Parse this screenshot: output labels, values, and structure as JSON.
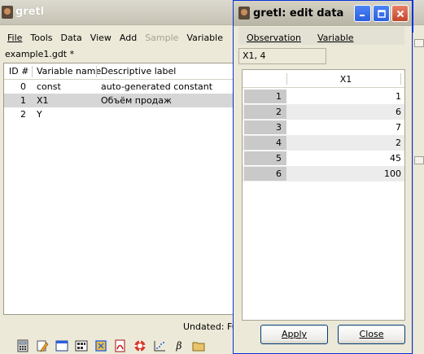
{
  "main_window": {
    "title": "gretl",
    "menus": [
      {
        "label": "File",
        "disabled": false
      },
      {
        "label": "Tools",
        "disabled": false
      },
      {
        "label": "Data",
        "disabled": false
      },
      {
        "label": "View",
        "disabled": false
      },
      {
        "label": "Add",
        "disabled": false
      },
      {
        "label": "Sample",
        "disabled": true
      },
      {
        "label": "Variable",
        "disabled": false
      }
    ],
    "file_label": "example1.gdt *",
    "columns": [
      "ID #",
      "Variable name",
      "Descriptive label"
    ],
    "variables": [
      {
        "id": "0",
        "name": "const",
        "label": "auto-generated constant",
        "selected": false
      },
      {
        "id": "1",
        "name": "X1",
        "label": "Объём продаж",
        "selected": true
      },
      {
        "id": "2",
        "name": "Y",
        "label": "",
        "selected": false
      }
    ],
    "status": "Undated: Fu",
    "toolbar_icons": [
      "calculator-icon",
      "edit-script-icon",
      "console-icon",
      "session-icon",
      "function-package-icon",
      "pdf-manual-icon",
      "help-lifebuoy-icon",
      "scatter-plot-icon",
      "ols-beta-icon",
      "folder-icon"
    ]
  },
  "edit_dialog": {
    "title": "gretl: edit data",
    "menus": [
      "Observation",
      "Variable"
    ],
    "cell_ref": "X1, 4",
    "column_header": "X1",
    "rows": [
      {
        "obs": "1",
        "value": "1"
      },
      {
        "obs": "2",
        "value": "6"
      },
      {
        "obs": "3",
        "value": "7"
      },
      {
        "obs": "4",
        "value": "2"
      },
      {
        "obs": "5",
        "value": "45"
      },
      {
        "obs": "6",
        "value": "100"
      }
    ],
    "apply_label": "Apply",
    "close_label": "Close"
  },
  "colors": {
    "selection_row": "#d6d6d6",
    "obs_cell": "#c9c9c9",
    "xp_blue": "#2a5fde",
    "xp_close_red": "#c2452b"
  }
}
